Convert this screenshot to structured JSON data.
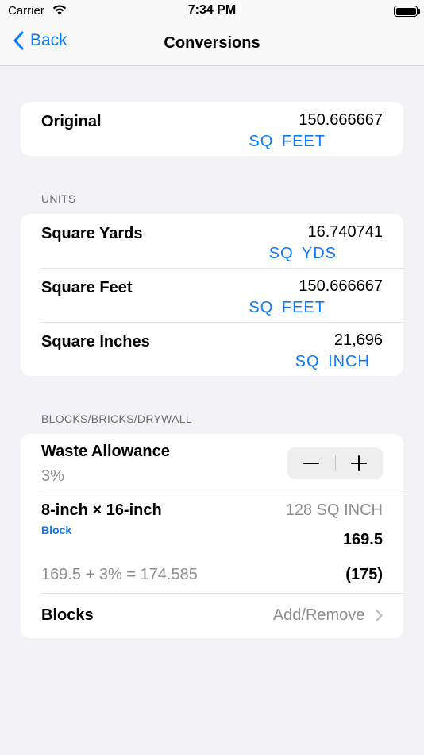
{
  "status": {
    "carrier": "Carrier",
    "time": "7:34 PM"
  },
  "nav": {
    "back_label": "Back",
    "title": "Conversions"
  },
  "original": {
    "label": "Original",
    "value": "150.666667",
    "unit": "SQ  FEET"
  },
  "units": {
    "header": "UNITS",
    "rows": [
      {
        "label": "Square Yards",
        "value": "16.740741",
        "unit": "SQ  YDS"
      },
      {
        "label": "Square Feet",
        "value": "150.666667",
        "unit": "SQ  FEET"
      },
      {
        "label": "Square Inches",
        "value": "21,696",
        "unit": "SQ  INCH"
      }
    ]
  },
  "blocks": {
    "header": "BLOCKS/BRICKS/DRYWALL",
    "waste": {
      "label": "Waste Allowance",
      "value": "3%"
    },
    "item": {
      "label": "8-inch × 16-inch",
      "sublabel": "Block",
      "area": "128 SQ INCH",
      "count": "169.5"
    },
    "formula": {
      "text": "169.5 + 3% = 174.585",
      "total": "(175)"
    },
    "list": {
      "label": "Blocks",
      "action": "Add/Remove"
    }
  }
}
